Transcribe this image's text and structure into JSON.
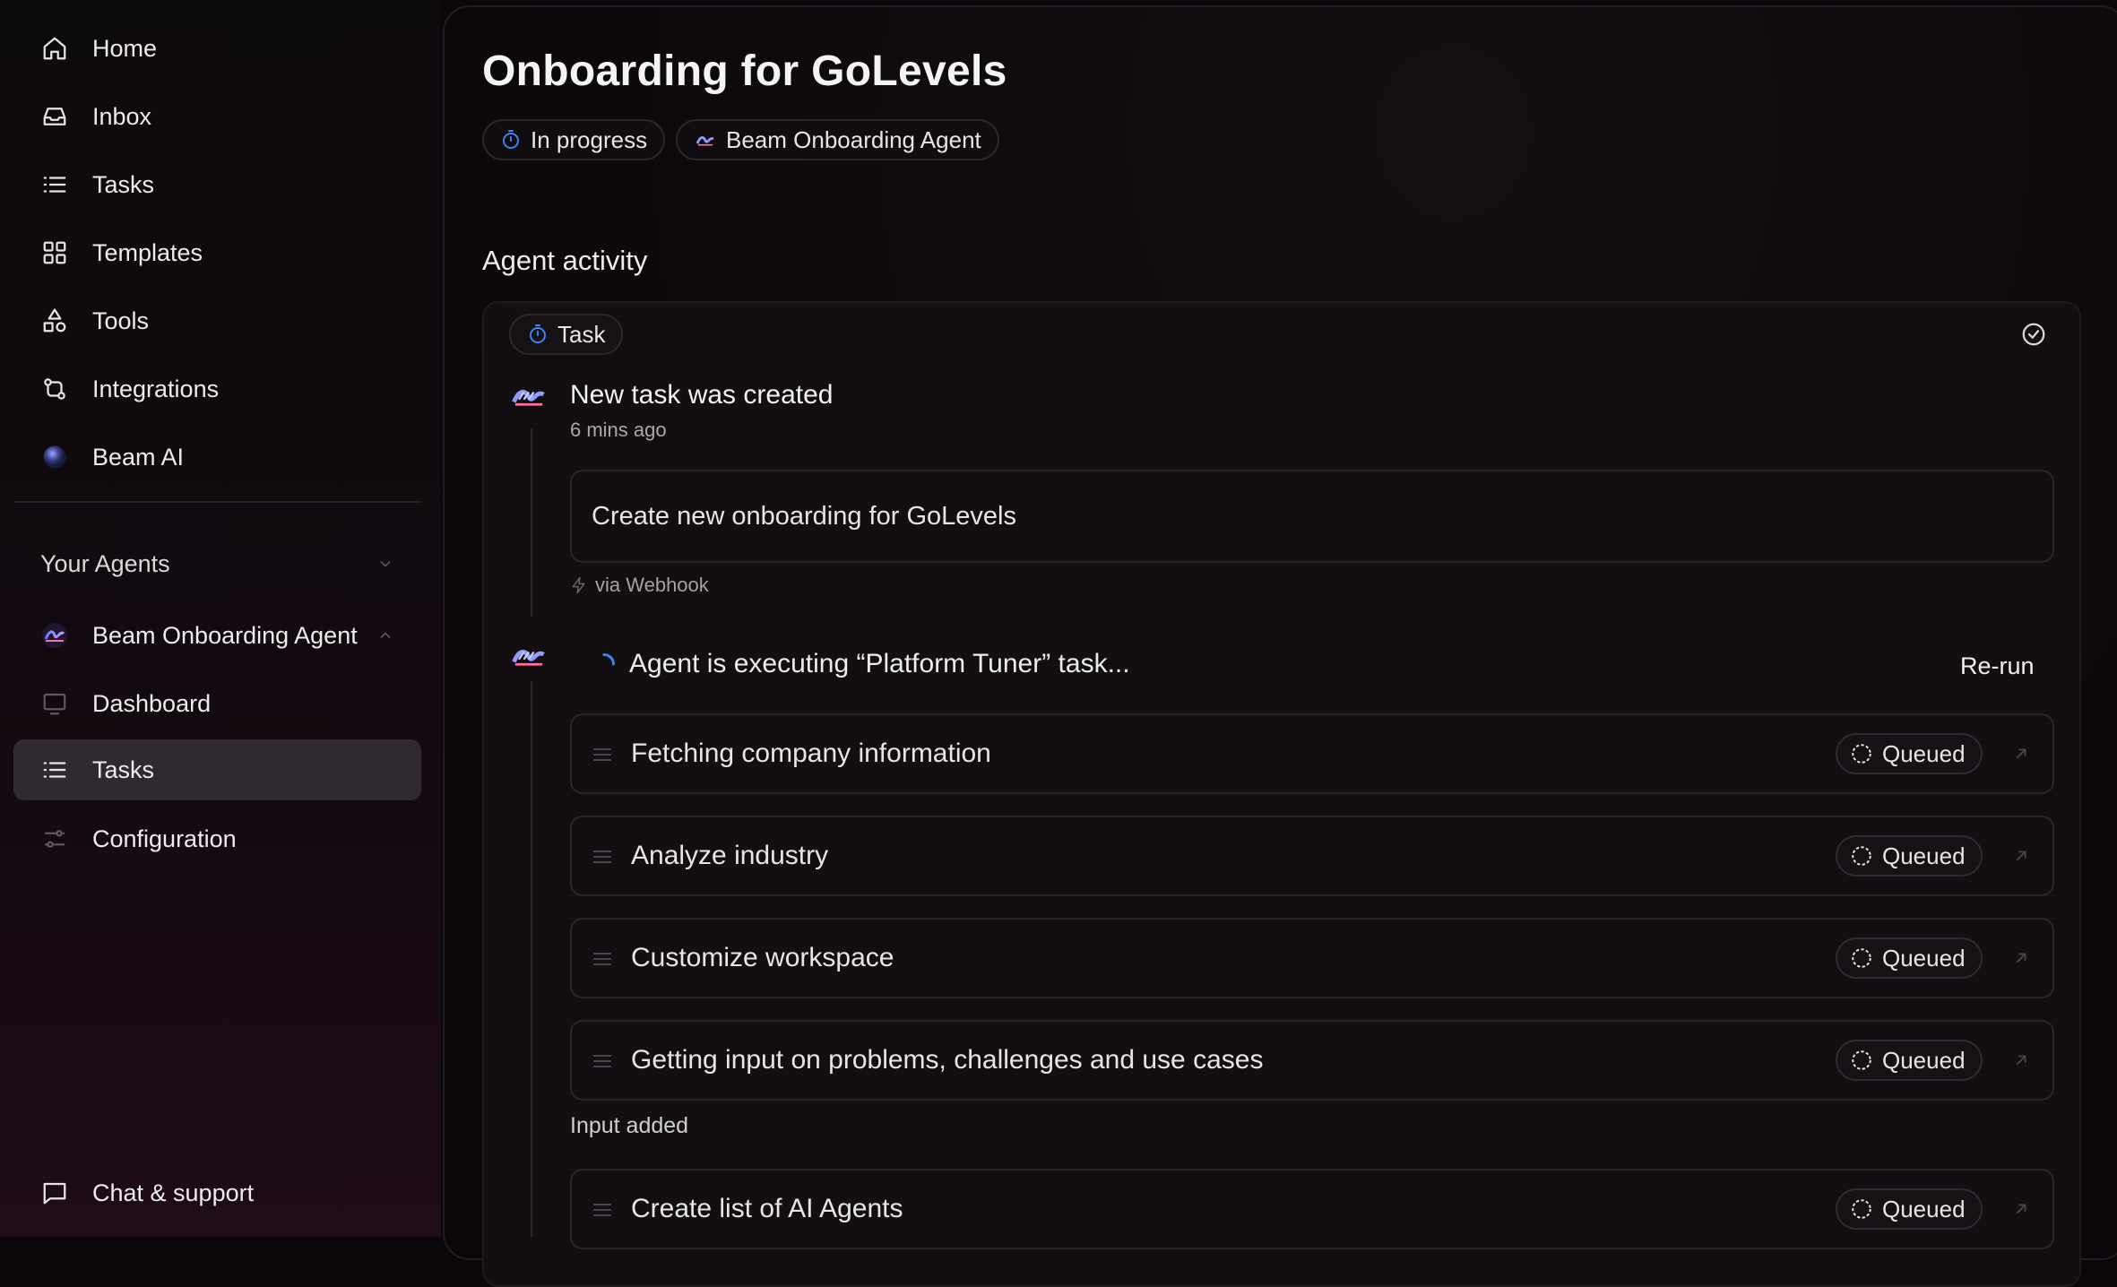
{
  "sidebar": {
    "nav": [
      {
        "label": "Home",
        "icon": "home-icon"
      },
      {
        "label": "Inbox",
        "icon": "inbox-icon"
      },
      {
        "label": "Tasks",
        "icon": "list-icon"
      },
      {
        "label": "Templates",
        "icon": "grid-icon"
      },
      {
        "label": "Tools",
        "icon": "shapes-icon"
      },
      {
        "label": "Integrations",
        "icon": "git-compare-icon"
      },
      {
        "label": "Beam AI",
        "icon": "beam-orb-icon"
      }
    ],
    "agents_section_label": "Your Agents",
    "agent": {
      "label": "Beam Onboarding Agent",
      "icon": "beam-agent-icon"
    },
    "agent_items": [
      {
        "label": "Dashboard",
        "icon": "monitor-icon"
      },
      {
        "label": "Tasks",
        "icon": "list-icon",
        "active": true
      },
      {
        "label": "Configuration",
        "icon": "sliders-icon"
      }
    ],
    "chat_label": "Chat & support"
  },
  "header": {
    "title": "Onboarding for GoLevels",
    "status_pill": "In progress",
    "agent_pill": "Beam Onboarding Agent"
  },
  "activity": {
    "section_title": "Agent activity",
    "type_pill": "Task",
    "event": {
      "title": "New task was created",
      "time": "6 mins ago",
      "message": "Create new onboarding for GoLevels",
      "via": "via Webhook"
    },
    "execution": {
      "text": "Agent  is executing “Platform Tuner” task...",
      "rerun_label": "Re-run"
    },
    "tasks": [
      {
        "label": "Fetching company information",
        "status": "Queued"
      },
      {
        "label": "Analyze industry",
        "status": "Queued"
      },
      {
        "label": "Customize workspace",
        "status": "Queued"
      },
      {
        "label": "Getting input on problems, challenges and use cases",
        "status": "Queued"
      },
      {
        "label": "Create list of AI Agents",
        "status": "Queued"
      }
    ],
    "input_added": "Input added"
  },
  "colors": {
    "background": "#0b0609",
    "active_item": "#302a30",
    "accent_blue": "#3b82f6",
    "border": "#2a262a"
  }
}
